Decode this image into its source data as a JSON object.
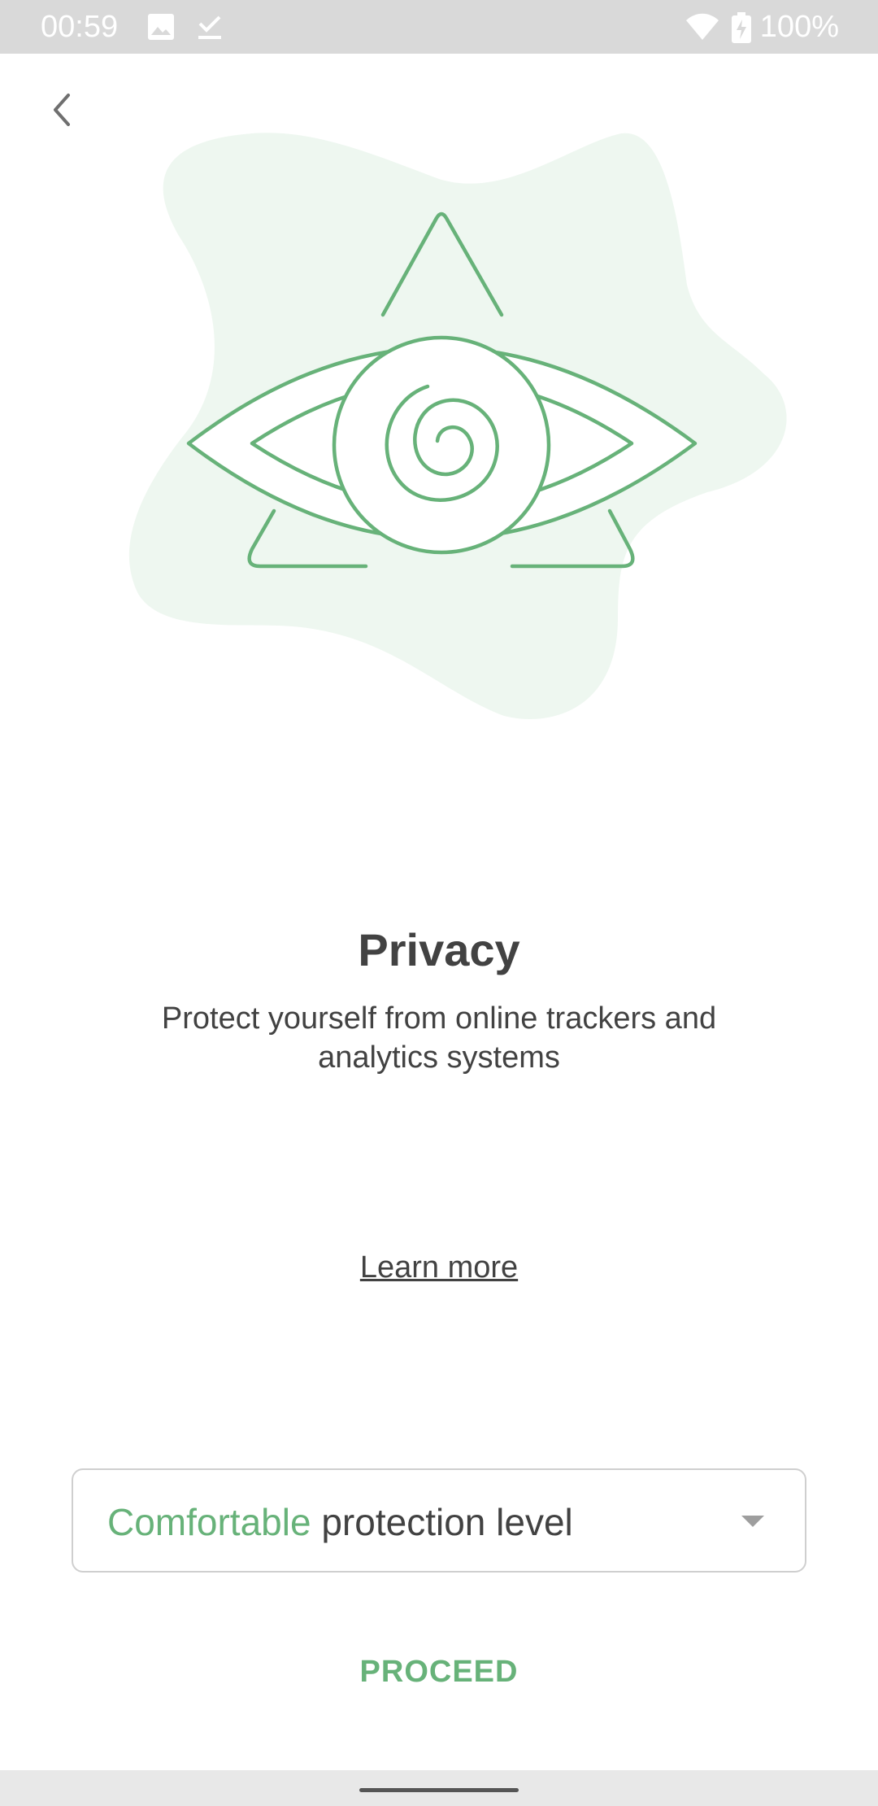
{
  "status_bar": {
    "time": "00:59",
    "battery": "100%",
    "icons": [
      "image-icon",
      "download-done-icon",
      "wifi-icon",
      "battery-charging-icon"
    ]
  },
  "navigation": {
    "back_icon": "chevron-left-icon"
  },
  "illustration": {
    "icon": "eye-triangle-illustration",
    "accent_color": "#67b279",
    "blob_color": "#eef7f0"
  },
  "content": {
    "title": "Privacy",
    "subtitle": "Protect yourself from online trackers and analytics systems",
    "learn_more": "Learn more"
  },
  "protection_dropdown": {
    "selected_level": "Comfortable",
    "suffix": "protection level",
    "arrow_icon": "dropdown-arrow-icon"
  },
  "actions": {
    "proceed_label": "PROCEED"
  },
  "colors": {
    "accent": "#67b279",
    "text": "#424242",
    "status_bar": "#d9d9d9"
  }
}
